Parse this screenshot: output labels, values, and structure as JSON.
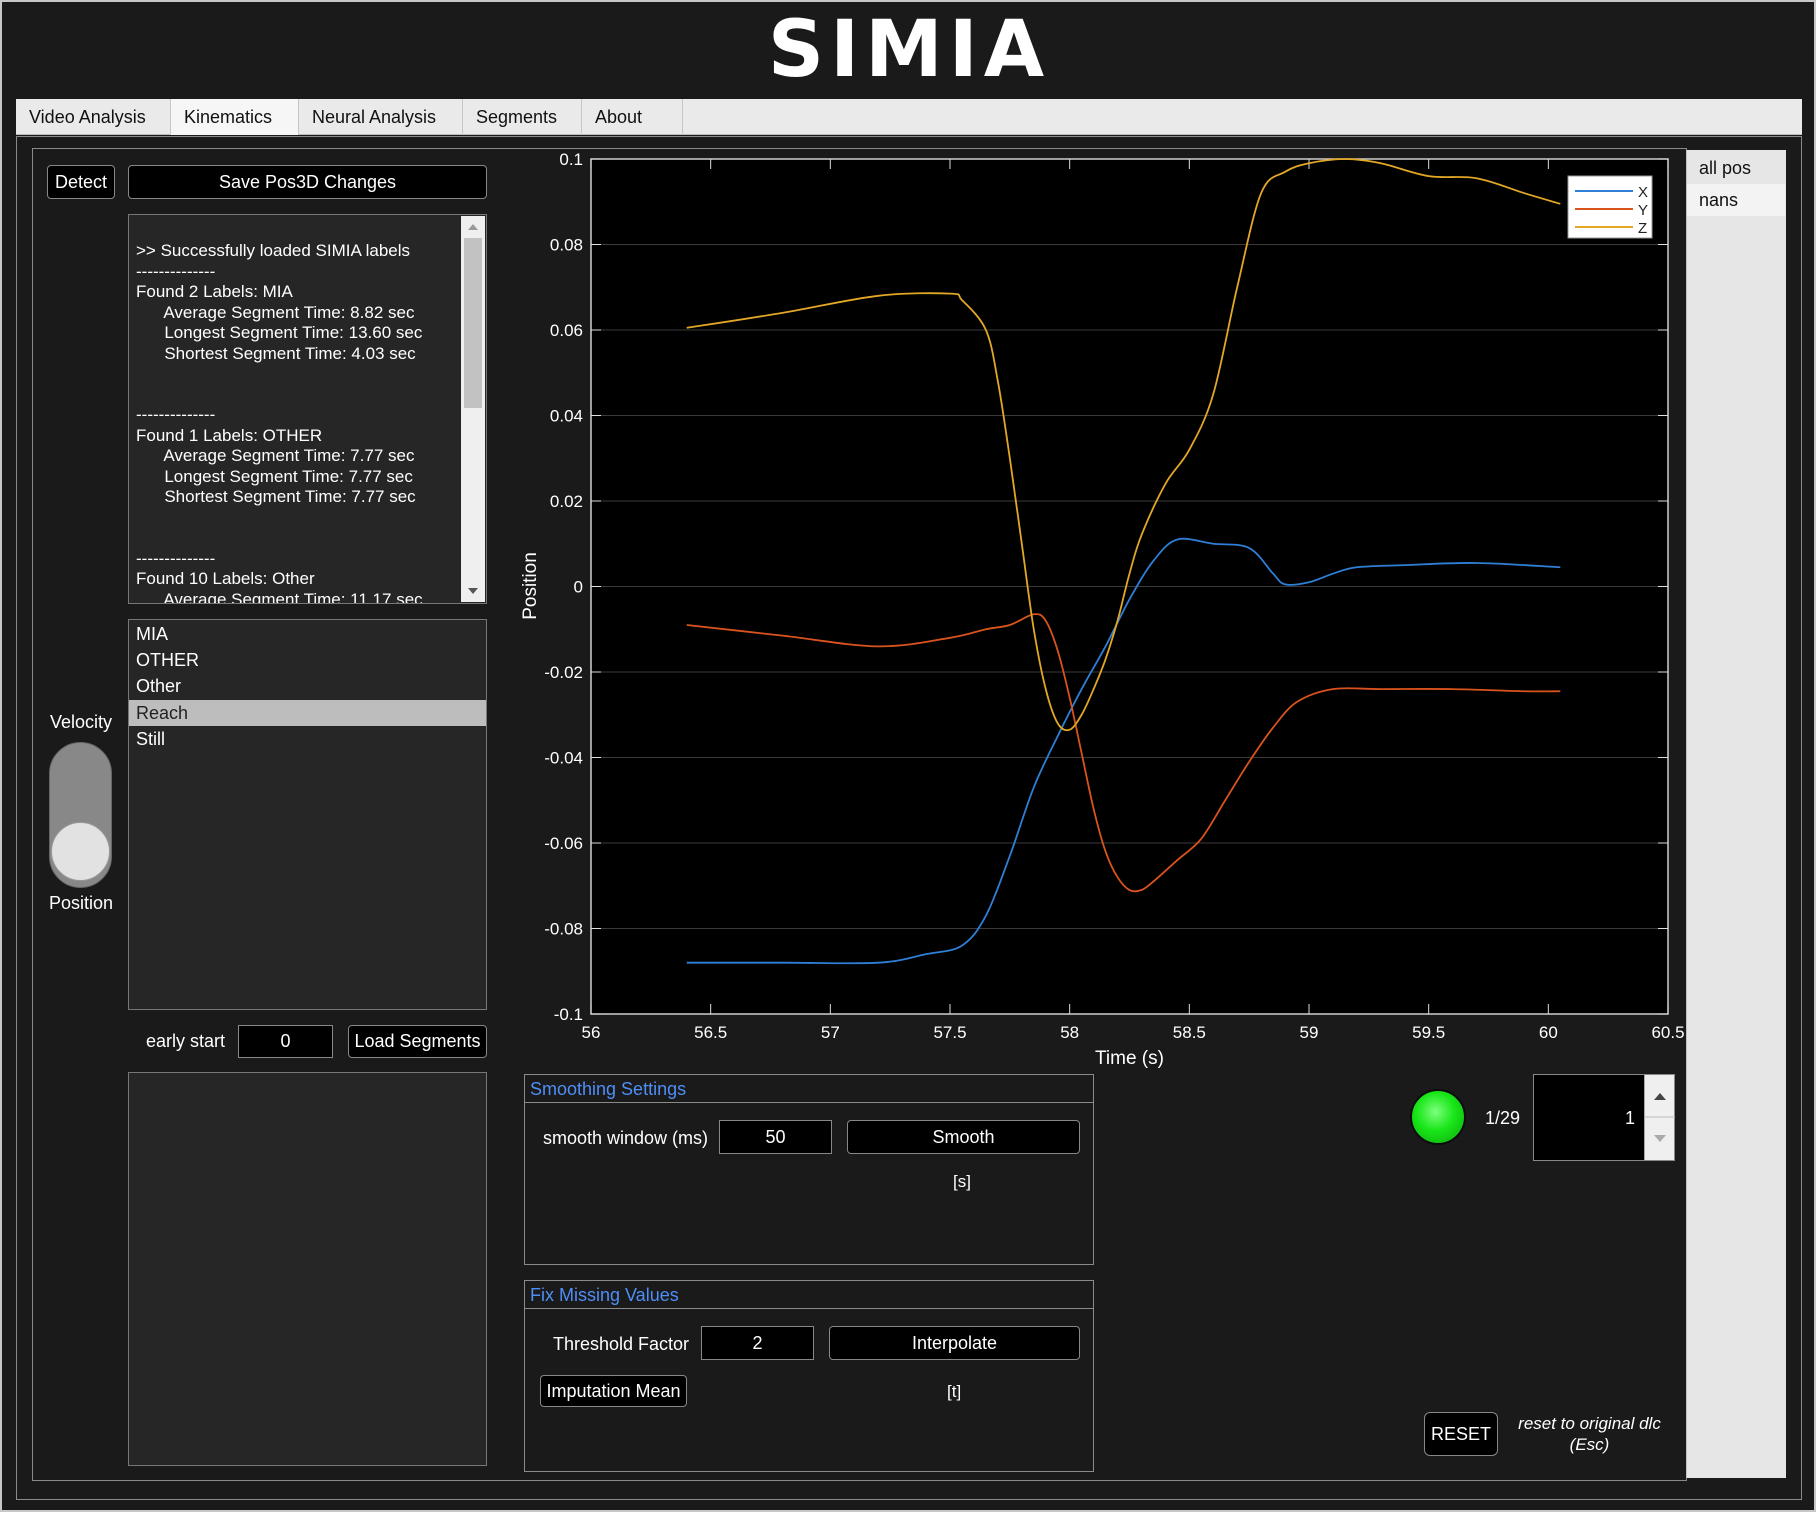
{
  "app": {
    "title": "SIMIA"
  },
  "tabs": [
    {
      "label": "Video Analysis"
    },
    {
      "label": "Kinematics",
      "active": true
    },
    {
      "label": "Neural Analysis"
    },
    {
      "label": "Segments"
    },
    {
      "label": "About"
    }
  ],
  "toolbar": {
    "detect_label": "Detect",
    "save_label": "Save Pos3D Changes"
  },
  "log": {
    "lines": [
      ">> Successfully loaded SIMIA labels",
      "--------------",
      "Found 2 Labels: MIA",
      "      Average Segment Time: 8.82 sec",
      "      Longest Segment Time: 13.60 sec",
      "      Shortest Segment Time: 4.03 sec",
      "",
      "",
      "--------------",
      "Found 1 Labels: OTHER",
      "      Average Segment Time: 7.77 sec",
      "      Longest Segment Time: 7.77 sec",
      "      Shortest Segment Time: 7.77 sec",
      "",
      "",
      "--------------",
      "Found 10 Labels: Other",
      "      Average Segment Time: 11.17 sec"
    ]
  },
  "labels_list": {
    "items": [
      "MIA",
      "OTHER",
      "Other",
      "Reach",
      "Still"
    ],
    "selected": "Reach"
  },
  "toggle": {
    "top_label": "Velocity",
    "bottom_label": "Position",
    "state": "Position"
  },
  "segments": {
    "early_start_label": "early start",
    "early_start_value": "0",
    "load_label": "Load Segments"
  },
  "right_list": {
    "items": [
      "all pos",
      "nans"
    ]
  },
  "smoothing": {
    "title": "Smoothing Settings",
    "window_label": "smooth window (ms)",
    "window_value": "50",
    "smooth_label": "Smooth",
    "unit_note": "[s]"
  },
  "fix_missing": {
    "title": "Fix Missing Values",
    "threshold_label": "Threshold Factor",
    "threshold_value": "2",
    "interpolate_label": "Interpolate",
    "imputation_label": "Imputation Mean",
    "note": "[t]"
  },
  "navigator": {
    "counter": "1/29",
    "value": "1",
    "status_color": "#19e619"
  },
  "reset": {
    "label": "RESET",
    "note_line1": "reset to original dlc",
    "note_line2": "(Esc)"
  },
  "chart_data": {
    "type": "line",
    "xlabel": "Time (s)",
    "ylabel": "Position",
    "xlim": [
      56,
      60.5
    ],
    "ylim": [
      -0.1,
      0.1
    ],
    "xticks": [
      "56",
      "56.5",
      "57",
      "57.5",
      "58",
      "58.5",
      "59",
      "59.5",
      "60",
      "60.5"
    ],
    "yticks": [
      "0.1",
      "0.08",
      "0.06",
      "0.04",
      "0.02",
      "0",
      "-0.02",
      "-0.04",
      "-0.06",
      "-0.08",
      "-0.1"
    ],
    "grid": "y",
    "legend_position": "top-right",
    "series": [
      {
        "name": "X",
        "color": "#2f7fd6",
        "x": [
          56.4,
          56.8,
          57.2,
          57.4,
          57.55,
          57.65,
          57.75,
          57.85,
          57.95,
          58.05,
          58.15,
          58.25,
          58.35,
          58.45,
          58.6,
          58.75,
          58.85,
          58.9,
          59.0,
          59.1,
          59.2,
          59.4,
          59.7,
          60.05
        ],
        "y": [
          -0.088,
          -0.088,
          -0.088,
          -0.086,
          -0.084,
          -0.077,
          -0.063,
          -0.047,
          -0.035,
          -0.024,
          -0.014,
          -0.003,
          0.006,
          0.011,
          0.01,
          0.009,
          0.003,
          0.0005,
          0.001,
          0.003,
          0.0045,
          0.005,
          0.0055,
          0.0045
        ]
      },
      {
        "name": "Y",
        "color": "#d9531e",
        "x": [
          56.4,
          56.8,
          57.2,
          57.5,
          57.65,
          57.75,
          57.85,
          57.9,
          57.95,
          58.0,
          58.05,
          58.1,
          58.15,
          58.2,
          58.25,
          58.3,
          58.35,
          58.45,
          58.55,
          58.65,
          58.75,
          58.85,
          58.95,
          59.1,
          59.3,
          59.6,
          59.9,
          60.05
        ],
        "y": [
          -0.009,
          -0.0115,
          -0.014,
          -0.012,
          -0.01,
          -0.009,
          -0.0065,
          -0.008,
          -0.015,
          -0.026,
          -0.039,
          -0.052,
          -0.062,
          -0.068,
          -0.071,
          -0.071,
          -0.069,
          -0.064,
          -0.059,
          -0.05,
          -0.041,
          -0.033,
          -0.027,
          -0.024,
          -0.024,
          -0.024,
          -0.0245,
          -0.0245
        ]
      },
      {
        "name": "Z",
        "color": "#e3a726",
        "x": [
          56.4,
          56.8,
          57.2,
          57.5,
          57.55,
          57.65,
          57.7,
          57.75,
          57.8,
          57.85,
          57.9,
          57.95,
          58.0,
          58.05,
          58.1,
          58.15,
          58.2,
          58.25,
          58.3,
          58.4,
          58.5,
          58.6,
          58.7,
          58.8,
          58.9,
          59.0,
          59.15,
          59.3,
          59.5,
          59.7,
          59.9,
          60.05
        ],
        "y": [
          0.0605,
          0.064,
          0.068,
          0.0685,
          0.067,
          0.06,
          0.048,
          0.03,
          0.01,
          -0.01,
          -0.024,
          -0.032,
          -0.0335,
          -0.03,
          -0.024,
          -0.017,
          -0.008,
          0.003,
          0.012,
          0.024,
          0.032,
          0.045,
          0.07,
          0.092,
          0.097,
          0.099,
          0.1,
          0.099,
          0.096,
          0.0955,
          0.092,
          0.0895
        ]
      }
    ]
  }
}
